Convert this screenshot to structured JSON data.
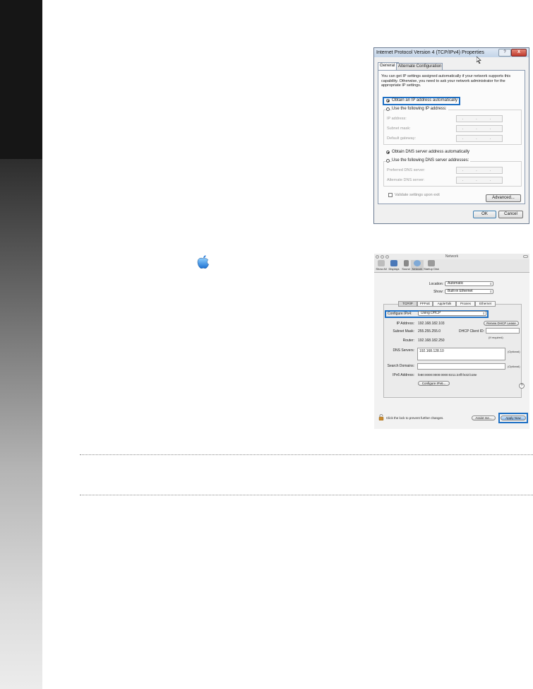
{
  "win_dialog": {
    "title": "Internet Protocol Version 4 (TCP/IPv4) Properties",
    "help_button": "?",
    "close_button": "X",
    "tabs": [
      "General",
      "Alternate Configuration"
    ],
    "description": "You can get IP settings assigned automatically if your network supports this capability. Otherwise, you need to ask your network administrator for the appropriate IP settings.",
    "obtain_ip_auto": "Obtain an IP address automatically",
    "use_following_ip": "Use the following IP address:",
    "ip_address_label": "IP address:",
    "subnet_mask_label": "Subnet mask:",
    "default_gateway_label": "Default gateway:",
    "obtain_dns_auto": "Obtain DNS server address automatically",
    "use_following_dns": "Use the following DNS server addresses:",
    "preferred_dns_label": "Preferred DNS server:",
    "alternate_dns_label": "Alternate DNS server:",
    "ip_placeholder": ". . .",
    "validate_label": "Validate settings upon exit",
    "advanced_button": "Advanced...",
    "ok_button": "OK",
    "cancel_button": "Cancel"
  },
  "mac_dialog": {
    "title": "Network",
    "toolbar": [
      "Show All",
      "Displays",
      "Sound",
      "Network",
      "Startup Disk"
    ],
    "location_label": "Location:",
    "location_value": "Automatic",
    "show_label": "Show:",
    "show_value": "Built-in Ethernet",
    "tabs": [
      "TCP/IP",
      "PPPoE",
      "AppleTalk",
      "Proxies",
      "Ethernet"
    ],
    "configure_label": "Configure IPv4:",
    "configure_value": "Using DHCP",
    "ip_label": "IP Address:",
    "ip_value": "192.168.182.103",
    "renew_button": "Renew DHCP Lease",
    "subnet_label": "Subnet Mask:",
    "subnet_value": "255.255.255.0",
    "client_id_label": "DHCP Client ID:",
    "if_required": "(If required)",
    "router_label": "Router:",
    "router_value": "192.168.182.250",
    "dns_label": "DNS Servers:",
    "dns_value": "192.168.128.10",
    "optional": "(Optional)",
    "search_label": "Search Domains:",
    "ipv6_label": "IPv6 Address:",
    "ipv6_value": "fe80:0000:0000:0000:0211:24ff:fe32:b18e",
    "configure_ipv6_button": "Configure IPv6...",
    "help_button": "?",
    "lock_text": "Click the lock to prevent further changes.",
    "assist_button": "Assist me...",
    "apply_button": "Apply Now"
  },
  "colors": {
    "highlight": "#1d6fc4",
    "sidebar_top": "#141414",
    "sidebar_bottom": "#ececec"
  },
  "icons": [
    "apple-logo-icon",
    "lock-icon",
    "cursor-icon"
  ]
}
